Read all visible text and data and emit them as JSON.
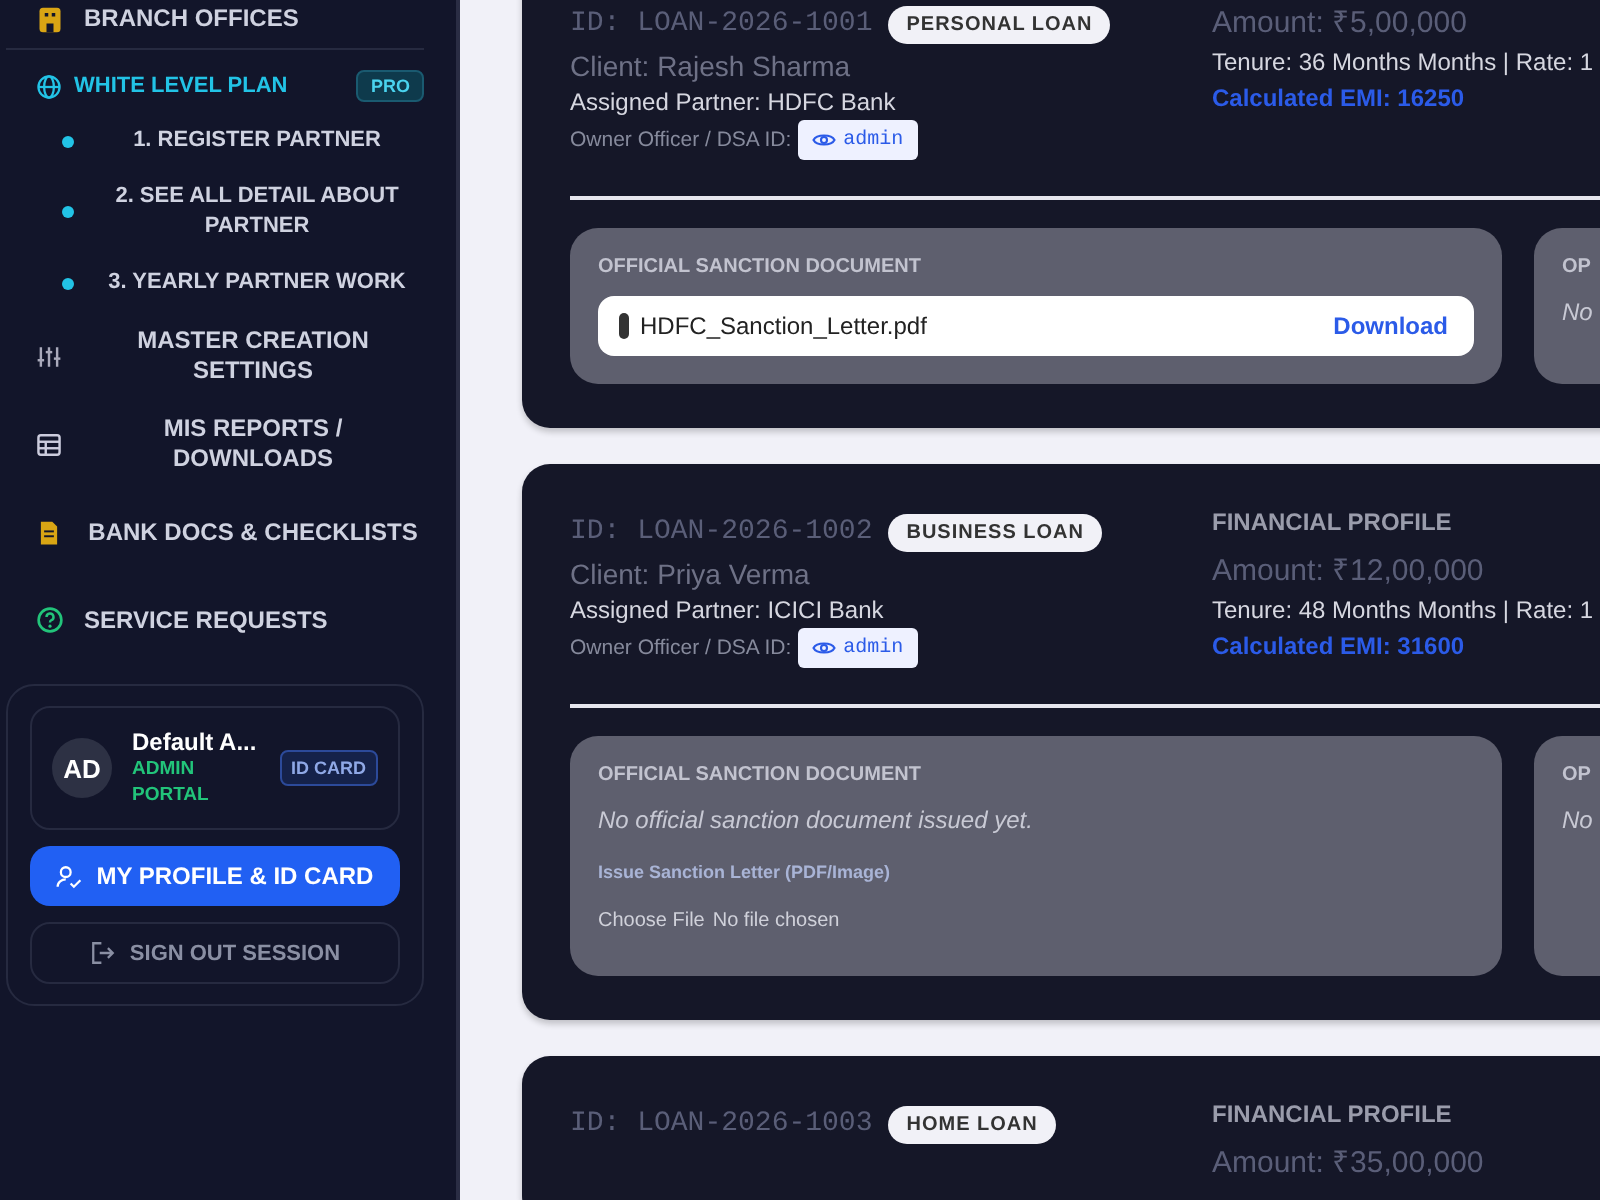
{
  "sidebar": {
    "top_item": {
      "label": "BRANCH OFFICES"
    },
    "plan": {
      "label": "WHITE LEVEL PLAN",
      "badge": "PRO",
      "children": [
        {
          "label": "1. REGISTER PARTNER"
        },
        {
          "label": "2. SEE ALL DETAIL ABOUT PARTNER"
        },
        {
          "label": "3. YEARLY PARTNER WORK"
        }
      ]
    },
    "items": [
      {
        "label": "MASTER CREATION SETTINGS"
      },
      {
        "label": "MIS REPORTS / DOWNLOADS"
      },
      {
        "label": "BANK DOCS & CHECKLISTS"
      },
      {
        "label": "SERVICE REQUESTS"
      }
    ],
    "profile": {
      "initials": "AD",
      "name": "Default A...",
      "role": "ADMIN PORTAL",
      "badge": "ID CARD",
      "profile_button": "MY PROFILE & ID CARD",
      "signout_button": "SIGN OUT SESSION"
    }
  },
  "loans": [
    {
      "id": "ID: LOAN-2026-1001",
      "type": "PERSONAL LOAN",
      "client": "Client: Rajesh Sharma",
      "partner": "Assigned Partner: HDFC Bank",
      "officer_label": "Owner Officer / DSA ID:",
      "officer_id": "admin",
      "amount": "Amount: ₹5,00,000",
      "tenure": "Tenure: 36 Months Months | Rate: 1",
      "emi": "Calculated EMI: 16250",
      "documents": [
        {
          "kind": "file",
          "heading": "OFFICIAL SANCTION DOCUMENT",
          "file_name": "HDFC_Sanction_Letter.pdf",
          "action": "Download"
        },
        {
          "kind": "empty",
          "heading": "OP",
          "note": "No"
        }
      ]
    },
    {
      "id": "ID: LOAN-2026-1002",
      "type": "BUSINESS LOAN",
      "client": "Client: Priya Verma",
      "partner": "Assigned Partner: ICICI Bank",
      "officer_label": "Owner Officer / DSA ID:",
      "officer_id": "admin",
      "heading": "FINANCIAL PROFILE",
      "amount": "Amount: ₹12,00,000",
      "tenure": "Tenure: 48 Months Months | Rate: 1",
      "emi": "Calculated EMI: 31600",
      "documents": [
        {
          "kind": "upload",
          "heading": "OFFICIAL SANCTION DOCUMENT",
          "note": "No official sanction document issued yet.",
          "upload_label": "Issue Sanction Letter (PDF/Image)",
          "file_button": "Choose File",
          "file_status": "No file chosen"
        },
        {
          "kind": "empty",
          "heading": "OP",
          "note": "No"
        }
      ]
    },
    {
      "id": "ID: LOAN-2026-1003",
      "type": "HOME LOAN",
      "heading": "FINANCIAL PROFILE",
      "amount": "Amount: ₹35,00,000"
    }
  ]
}
